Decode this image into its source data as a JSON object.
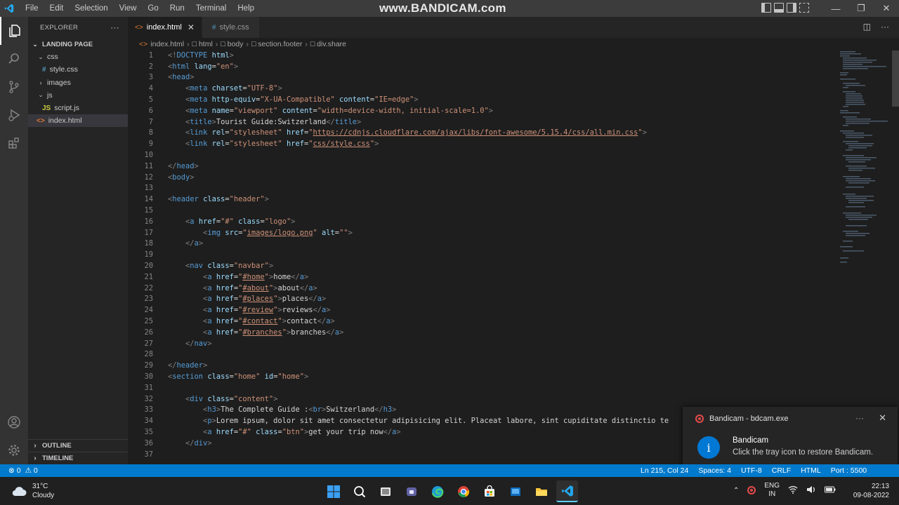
{
  "watermark": "www.BANDICAM.com",
  "menu": [
    "File",
    "Edit",
    "Selection",
    "View",
    "Go",
    "Run",
    "Terminal",
    "Help"
  ],
  "sidebar": {
    "title": "EXPLORER",
    "more": "···",
    "tree": [
      {
        "label": "LANDING PAGE",
        "kind": "root",
        "chevron": "⌄",
        "depth": 0
      },
      {
        "label": "css",
        "kind": "folder",
        "chevron": "⌄",
        "depth": 1
      },
      {
        "label": "style.css",
        "kind": "css",
        "icon": "#",
        "depth": 2
      },
      {
        "label": "images",
        "kind": "folder",
        "chevron": "›",
        "depth": 1
      },
      {
        "label": "js",
        "kind": "folder",
        "chevron": "⌄",
        "depth": 1
      },
      {
        "label": "script.js",
        "kind": "js",
        "icon": "JS",
        "depth": 2
      },
      {
        "label": "index.html",
        "kind": "html",
        "icon": "<>",
        "depth": 1,
        "selected": true
      }
    ],
    "outline": "OUTLINE",
    "timeline": "TIMELINE"
  },
  "tabs": [
    {
      "label": "index.html",
      "icon": "<>",
      "active": true,
      "close": "✕"
    },
    {
      "label": "style.css",
      "icon": "#",
      "active": false
    }
  ],
  "breadcrumb": [
    "index.html",
    "html",
    "body",
    "section.footer",
    "div.share"
  ],
  "code_lines": [
    {
      "n": "1",
      "t": [
        [
          "tag",
          "<!"
        ],
        [
          "tn",
          "DOCTYPE"
        ],
        [
          "an",
          " html"
        ],
        [
          "tag",
          ">"
        ]
      ]
    },
    {
      "n": "2",
      "t": [
        [
          "tag",
          "<"
        ],
        [
          "tn",
          "html"
        ],
        [
          "an",
          " lang"
        ],
        [
          "tx",
          "="
        ],
        [
          "av",
          "\"en\""
        ],
        [
          "tag",
          ">"
        ]
      ]
    },
    {
      "n": "3",
      "t": [
        [
          "tag",
          "<"
        ],
        [
          "tn",
          "head"
        ],
        [
          "tag",
          ">"
        ]
      ]
    },
    {
      "n": "4",
      "t": [
        [
          "tx",
          "    "
        ],
        [
          "tag",
          "<"
        ],
        [
          "tn",
          "meta"
        ],
        [
          "an",
          " charset"
        ],
        [
          "tx",
          "="
        ],
        [
          "av",
          "\"UTF-8\""
        ],
        [
          "tag",
          ">"
        ]
      ]
    },
    {
      "n": "5",
      "t": [
        [
          "tx",
          "    "
        ],
        [
          "tag",
          "<"
        ],
        [
          "tn",
          "meta"
        ],
        [
          "an",
          " http-equiv"
        ],
        [
          "tx",
          "="
        ],
        [
          "av",
          "\"X-UA-Compatible\""
        ],
        [
          "an",
          " content"
        ],
        [
          "tx",
          "="
        ],
        [
          "av",
          "\"IE=edge\""
        ],
        [
          "tag",
          ">"
        ]
      ]
    },
    {
      "n": "6",
      "t": [
        [
          "tx",
          "    "
        ],
        [
          "tag",
          "<"
        ],
        [
          "tn",
          "meta"
        ],
        [
          "an",
          " name"
        ],
        [
          "tx",
          "="
        ],
        [
          "av",
          "\"viewport\""
        ],
        [
          "an",
          " content"
        ],
        [
          "tx",
          "="
        ],
        [
          "av",
          "\"width=device-width, initial-scale=1.0\""
        ],
        [
          "tag",
          ">"
        ]
      ]
    },
    {
      "n": "7",
      "t": [
        [
          "tx",
          "    "
        ],
        [
          "tag",
          "<"
        ],
        [
          "tn",
          "title"
        ],
        [
          "tag",
          ">"
        ],
        [
          "tx",
          "Tourist Guide:Switzerland"
        ],
        [
          "tag",
          "</"
        ],
        [
          "tn",
          "title"
        ],
        [
          "tag",
          ">"
        ]
      ]
    },
    {
      "n": "8",
      "t": [
        [
          "tx",
          "    "
        ],
        [
          "tag",
          "<"
        ],
        [
          "tn",
          "link"
        ],
        [
          "an",
          " rel"
        ],
        [
          "tx",
          "="
        ],
        [
          "av",
          "\"stylesheet\""
        ],
        [
          "an",
          " href"
        ],
        [
          "tx",
          "="
        ],
        [
          "av",
          "\""
        ],
        [
          "avu",
          "https://cdnjs.cloudflare.com/ajax/libs/font-awesome/5.15.4/css/all.min.css"
        ],
        [
          "av",
          "\""
        ],
        [
          "tag",
          ">"
        ]
      ]
    },
    {
      "n": "9",
      "t": [
        [
          "tx",
          "    "
        ],
        [
          "tag",
          "<"
        ],
        [
          "tn",
          "link"
        ],
        [
          "an",
          " rel"
        ],
        [
          "tx",
          "="
        ],
        [
          "av",
          "\"stylesheet\""
        ],
        [
          "an",
          " href"
        ],
        [
          "tx",
          "="
        ],
        [
          "av",
          "\""
        ],
        [
          "avu",
          "css/style.css"
        ],
        [
          "av",
          "\""
        ],
        [
          "tag",
          ">"
        ]
      ]
    },
    {
      "n": "10",
      "t": []
    },
    {
      "n": "11",
      "t": [
        [
          "tag",
          "</"
        ],
        [
          "tn",
          "head"
        ],
        [
          "tag",
          ">"
        ]
      ]
    },
    {
      "n": "12",
      "t": [
        [
          "tag",
          "<"
        ],
        [
          "tn",
          "body"
        ],
        [
          "tag",
          ">"
        ]
      ]
    },
    {
      "n": "13",
      "t": []
    },
    {
      "n": "14",
      "t": [
        [
          "tag",
          "<"
        ],
        [
          "tn",
          "header"
        ],
        [
          "an",
          " class"
        ],
        [
          "tx",
          "="
        ],
        [
          "av",
          "\"header\""
        ],
        [
          "tag",
          ">"
        ]
      ]
    },
    {
      "n": "15",
      "t": []
    },
    {
      "n": "16",
      "t": [
        [
          "tx",
          "    "
        ],
        [
          "tag",
          "<"
        ],
        [
          "tn",
          "a"
        ],
        [
          "an",
          " href"
        ],
        [
          "tx",
          "="
        ],
        [
          "av",
          "\"#\""
        ],
        [
          "an",
          " class"
        ],
        [
          "tx",
          "="
        ],
        [
          "av",
          "\"logo\""
        ],
        [
          "tag",
          ">"
        ]
      ]
    },
    {
      "n": "17",
      "t": [
        [
          "tx",
          "        "
        ],
        [
          "tag",
          "<"
        ],
        [
          "tn",
          "img"
        ],
        [
          "an",
          " src"
        ],
        [
          "tx",
          "="
        ],
        [
          "av",
          "\""
        ],
        [
          "avu",
          "images/logo.png"
        ],
        [
          "av",
          "\""
        ],
        [
          "an",
          " alt"
        ],
        [
          "tx",
          "="
        ],
        [
          "av",
          "\"\""
        ],
        [
          "tag",
          ">"
        ]
      ]
    },
    {
      "n": "18",
      "t": [
        [
          "tx",
          "    "
        ],
        [
          "tag",
          "</"
        ],
        [
          "tn",
          "a"
        ],
        [
          "tag",
          ">"
        ]
      ]
    },
    {
      "n": "19",
      "t": []
    },
    {
      "n": "20",
      "t": [
        [
          "tx",
          "    "
        ],
        [
          "tag",
          "<"
        ],
        [
          "tn",
          "nav"
        ],
        [
          "an",
          " class"
        ],
        [
          "tx",
          "="
        ],
        [
          "av",
          "\"navbar\""
        ],
        [
          "tag",
          ">"
        ]
      ]
    },
    {
      "n": "21",
      "t": [
        [
          "tx",
          "        "
        ],
        [
          "tag",
          "<"
        ],
        [
          "tn",
          "a"
        ],
        [
          "an",
          " href"
        ],
        [
          "tx",
          "="
        ],
        [
          "av",
          "\""
        ],
        [
          "avu",
          "#home"
        ],
        [
          "av",
          "\""
        ],
        [
          "tag",
          ">"
        ],
        [
          "tx",
          "home"
        ],
        [
          "tag",
          "</"
        ],
        [
          "tn",
          "a"
        ],
        [
          "tag",
          ">"
        ]
      ]
    },
    {
      "n": "22",
      "t": [
        [
          "tx",
          "        "
        ],
        [
          "tag",
          "<"
        ],
        [
          "tn",
          "a"
        ],
        [
          "an",
          " href"
        ],
        [
          "tx",
          "="
        ],
        [
          "av",
          "\""
        ],
        [
          "avu",
          "#about"
        ],
        [
          "av",
          "\""
        ],
        [
          "tag",
          ">"
        ],
        [
          "tx",
          "about"
        ],
        [
          "tag",
          "</"
        ],
        [
          "tn",
          "a"
        ],
        [
          "tag",
          ">"
        ]
      ]
    },
    {
      "n": "23",
      "t": [
        [
          "tx",
          "        "
        ],
        [
          "tag",
          "<"
        ],
        [
          "tn",
          "a"
        ],
        [
          "an",
          " href"
        ],
        [
          "tx",
          "="
        ],
        [
          "av",
          "\""
        ],
        [
          "avu",
          "#places"
        ],
        [
          "av",
          "\""
        ],
        [
          "tag",
          ">"
        ],
        [
          "tx",
          "places"
        ],
        [
          "tag",
          "</"
        ],
        [
          "tn",
          "a"
        ],
        [
          "tag",
          ">"
        ]
      ]
    },
    {
      "n": "24",
      "t": [
        [
          "tx",
          "        "
        ],
        [
          "tag",
          "<"
        ],
        [
          "tn",
          "a"
        ],
        [
          "an",
          " href"
        ],
        [
          "tx",
          "="
        ],
        [
          "av",
          "\""
        ],
        [
          "avu",
          "#review"
        ],
        [
          "av",
          "\""
        ],
        [
          "tag",
          ">"
        ],
        [
          "tx",
          "reviews"
        ],
        [
          "tag",
          "</"
        ],
        [
          "tn",
          "a"
        ],
        [
          "tag",
          ">"
        ]
      ]
    },
    {
      "n": "25",
      "t": [
        [
          "tx",
          "        "
        ],
        [
          "tag",
          "<"
        ],
        [
          "tn",
          "a"
        ],
        [
          "an",
          " href"
        ],
        [
          "tx",
          "="
        ],
        [
          "av",
          "\""
        ],
        [
          "avu",
          "#contact"
        ],
        [
          "av",
          "\""
        ],
        [
          "tag",
          ">"
        ],
        [
          "tx",
          "contact"
        ],
        [
          "tag",
          "</"
        ],
        [
          "tn",
          "a"
        ],
        [
          "tag",
          ">"
        ]
      ]
    },
    {
      "n": "26",
      "t": [
        [
          "tx",
          "        "
        ],
        [
          "tag",
          "<"
        ],
        [
          "tn",
          "a"
        ],
        [
          "an",
          " href"
        ],
        [
          "tx",
          "="
        ],
        [
          "av",
          "\""
        ],
        [
          "avu",
          "#branches"
        ],
        [
          "av",
          "\""
        ],
        [
          "tag",
          ">"
        ],
        [
          "tx",
          "branches"
        ],
        [
          "tag",
          "</"
        ],
        [
          "tn",
          "a"
        ],
        [
          "tag",
          ">"
        ]
      ]
    },
    {
      "n": "27",
      "t": [
        [
          "tx",
          "    "
        ],
        [
          "tag",
          "</"
        ],
        [
          "tn",
          "nav"
        ],
        [
          "tag",
          ">"
        ]
      ]
    },
    {
      "n": "28",
      "t": []
    },
    {
      "n": "29",
      "t": [
        [
          "tag",
          "</"
        ],
        [
          "tn",
          "header"
        ],
        [
          "tag",
          ">"
        ]
      ]
    },
    {
      "n": "30",
      "t": [
        [
          "tag",
          "<"
        ],
        [
          "tn",
          "section"
        ],
        [
          "an",
          " class"
        ],
        [
          "tx",
          "="
        ],
        [
          "av",
          "\"home\""
        ],
        [
          "an",
          " id"
        ],
        [
          "tx",
          "="
        ],
        [
          "av",
          "\"home\""
        ],
        [
          "tag",
          ">"
        ]
      ]
    },
    {
      "n": "31",
      "t": []
    },
    {
      "n": "32",
      "t": [
        [
          "tx",
          "    "
        ],
        [
          "tag",
          "<"
        ],
        [
          "tn",
          "div"
        ],
        [
          "an",
          " class"
        ],
        [
          "tx",
          "="
        ],
        [
          "av",
          "\"content\""
        ],
        [
          "tag",
          ">"
        ]
      ]
    },
    {
      "n": "33",
      "t": [
        [
          "tx",
          "        "
        ],
        [
          "tag",
          "<"
        ],
        [
          "tn",
          "h3"
        ],
        [
          "tag",
          ">"
        ],
        [
          "tx",
          "The Complete Guide :"
        ],
        [
          "tag",
          "<"
        ],
        [
          "tn",
          "br"
        ],
        [
          "tag",
          ">"
        ],
        [
          "tx",
          "Switzerland"
        ],
        [
          "tag",
          "</"
        ],
        [
          "tn",
          "h3"
        ],
        [
          "tag",
          ">"
        ]
      ]
    },
    {
      "n": "34",
      "t": [
        [
          "tx",
          "        "
        ],
        [
          "tag",
          "<"
        ],
        [
          "tn",
          "p"
        ],
        [
          "tag",
          ">"
        ],
        [
          "tx",
          "Lorem ipsum, dolor sit amet consectetur adipisicing elit. Placeat labore, sint cupiditate distinctio te"
        ]
      ]
    },
    {
      "n": "35",
      "t": [
        [
          "tx",
          "        "
        ],
        [
          "tag",
          "<"
        ],
        [
          "tn",
          "a"
        ],
        [
          "an",
          " href"
        ],
        [
          "tx",
          "="
        ],
        [
          "av",
          "\"#\""
        ],
        [
          "an",
          " class"
        ],
        [
          "tx",
          "="
        ],
        [
          "av",
          "\"btn\""
        ],
        [
          "tag",
          ">"
        ],
        [
          "tx",
          "get your trip now"
        ],
        [
          "tag",
          "</"
        ],
        [
          "tn",
          "a"
        ],
        [
          "tag",
          ">"
        ]
      ]
    },
    {
      "n": "36",
      "t": [
        [
          "tx",
          "    "
        ],
        [
          "tag",
          "</"
        ],
        [
          "tn",
          "div"
        ],
        [
          "tag",
          ">"
        ]
      ]
    },
    {
      "n": "37",
      "t": []
    }
  ],
  "notification": {
    "source": "Bandicam - bdcam.exe",
    "more": "···",
    "close": "✕",
    "icon": "i",
    "title": "Bandicam",
    "message": "Click the tray icon to restore Bandicam."
  },
  "statusbar": {
    "errors": "⊗ 0",
    "warnings": "⚠ 0",
    "position": "Ln 215, Col 24",
    "spaces": "Spaces: 4",
    "encoding": "UTF-8",
    "eol": "CRLF",
    "language": "HTML",
    "port": "Port : 5500"
  },
  "taskbar": {
    "temperature": "31°C",
    "condition": "Cloudy",
    "lang_top": "ENG",
    "lang_bottom": "IN",
    "time": "22:13",
    "date": "09-08-2022"
  }
}
